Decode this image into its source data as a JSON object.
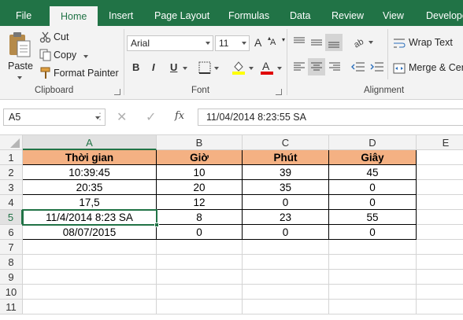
{
  "tabs": [
    "File",
    "Home",
    "Insert",
    "Page Layout",
    "Formulas",
    "Data",
    "Review",
    "View",
    "Develope"
  ],
  "active_tab": "Home",
  "ribbon": {
    "clipboard": {
      "paste": "Paste",
      "cut": "Cut",
      "copy": "Copy",
      "format_painter": "Format Painter",
      "group": "Clipboard"
    },
    "font": {
      "name": "Arial",
      "size": "11",
      "bold": "B",
      "italic": "I",
      "underline": "U",
      "group": "Font"
    },
    "alignment": {
      "wrap_text": "Wrap Text",
      "merge": "Merge & Cen",
      "group": "Alignment"
    }
  },
  "formula_bar": {
    "name_box": "A5",
    "cancel": "✕",
    "enter": "✓",
    "fx": "fx",
    "formula": "11/04/2014  8:23:55 SA"
  },
  "columns": [
    "A",
    "B",
    "C",
    "D",
    "E"
  ],
  "rows": [
    "1",
    "2",
    "3",
    "4",
    "5",
    "6",
    "7",
    "8",
    "9",
    "10",
    "11"
  ],
  "selected_cell": "A5",
  "table": {
    "headers": [
      "Thời gian",
      "Giờ",
      "Phút",
      "Giây"
    ],
    "rows": [
      [
        "10:39:45",
        "10",
        "39",
        "45"
      ],
      [
        "20:35",
        "20",
        "35",
        "0"
      ],
      [
        "17,5",
        "12",
        "0",
        "0"
      ],
      [
        "11/4/2014 8:23 SA",
        "8",
        "23",
        "55"
      ],
      [
        "08/07/2015",
        "0",
        "0",
        "0"
      ]
    ]
  },
  "colors": {
    "accent": "#217346",
    "header_fill": "#f4b183"
  }
}
